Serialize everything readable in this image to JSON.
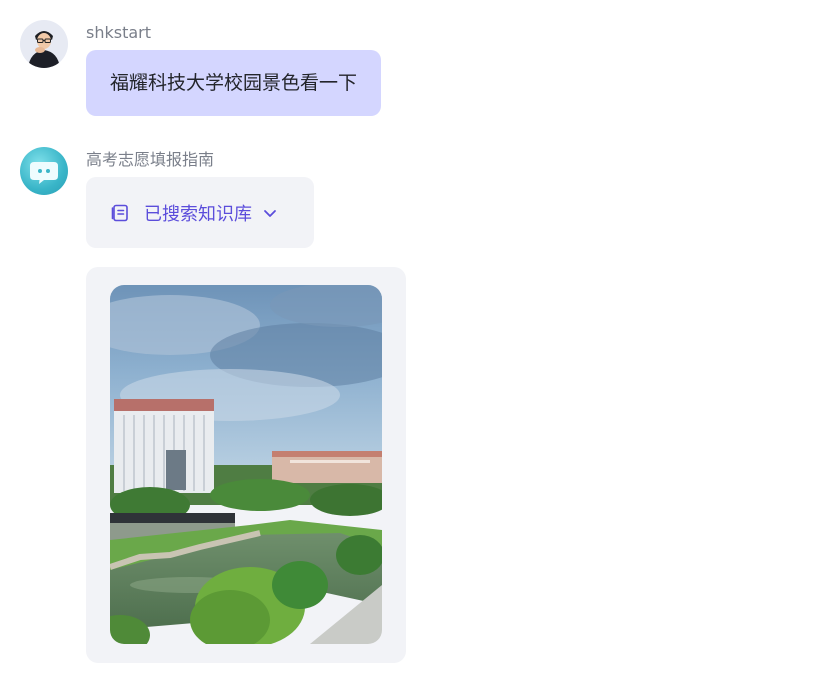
{
  "messages": {
    "user": {
      "name": "shkstart",
      "text": "福耀科技大学校园景色看一下"
    },
    "bot": {
      "name": "高考志愿填报指南",
      "kb_status": "已搜索知识库"
    }
  },
  "icons": {
    "kb_icon": "document-icon",
    "kb_toggle": "chevron-down-icon"
  },
  "colors": {
    "user_bubble": "#d4d6ff",
    "accent": "#5b4ddb",
    "card_bg": "#f2f3f7"
  }
}
